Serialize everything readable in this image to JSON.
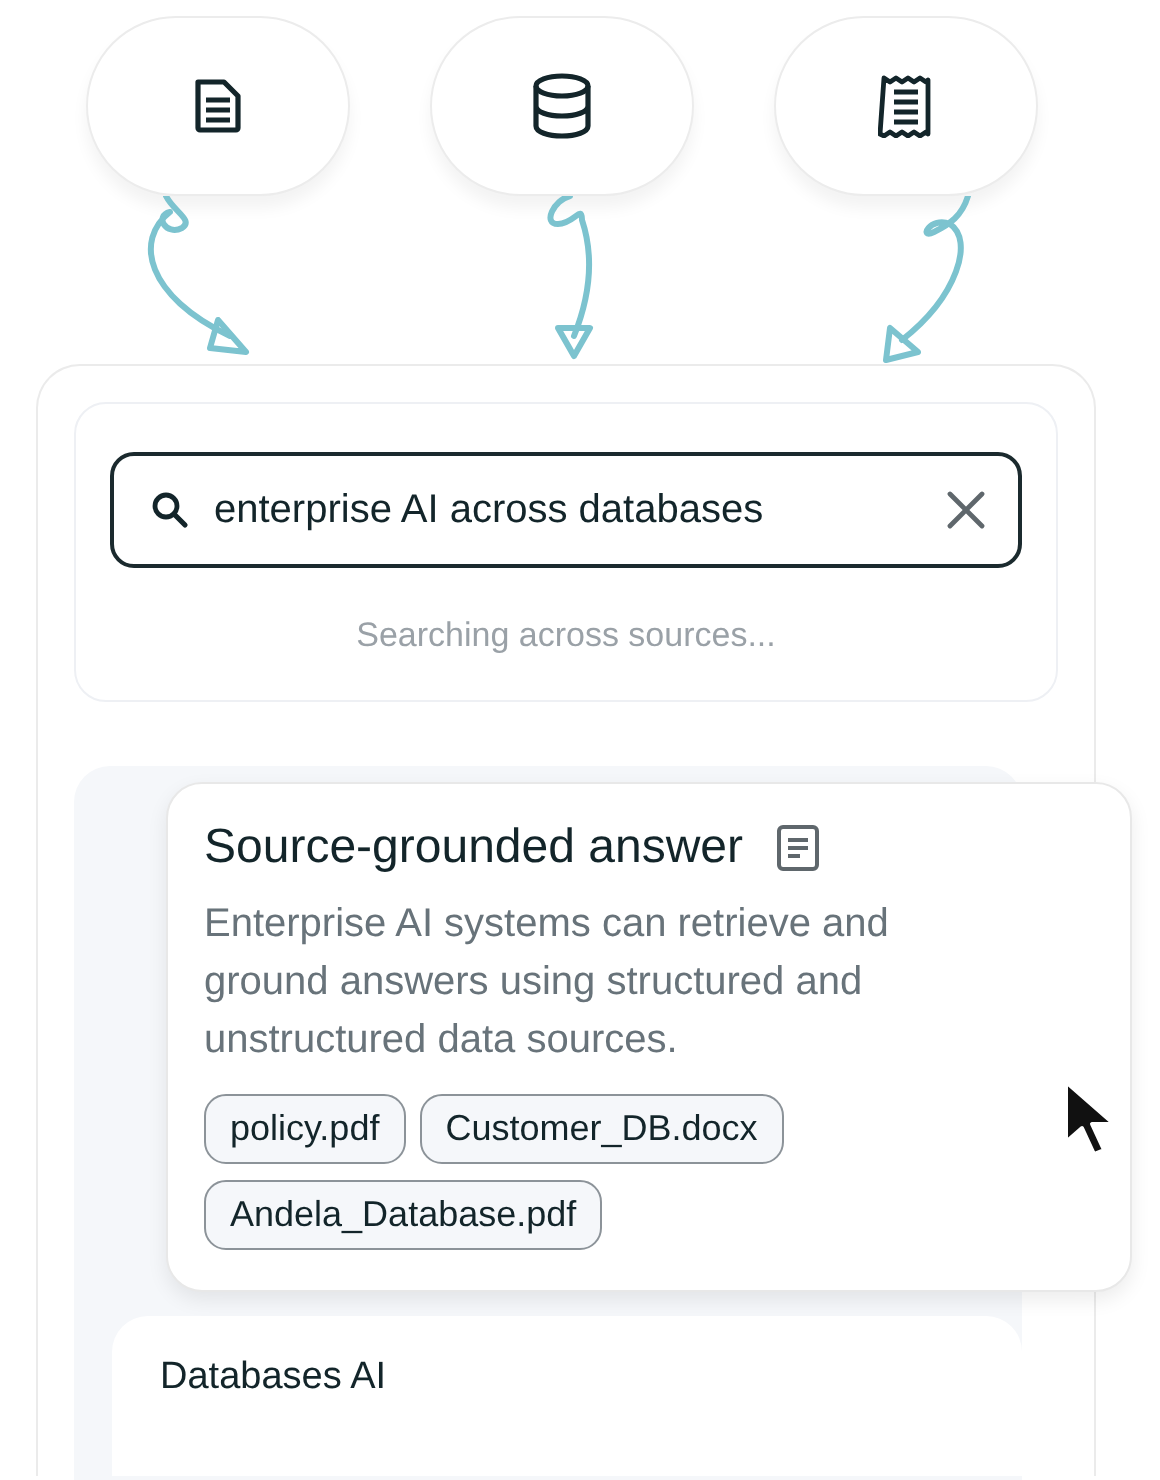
{
  "sources": [
    {
      "kind": "document"
    },
    {
      "kind": "database"
    },
    {
      "kind": "receipt"
    }
  ],
  "search": {
    "value": "enterprise AI across databases"
  },
  "status": "Searching across sources...",
  "answer": {
    "title": "Source-grounded answer",
    "text": "Enterprise AI systems can retrieve and ground answers using structured and unstructured data sources.",
    "sources": [
      "policy.pdf",
      "Customer_DB.docx",
      "Andela_Database.pdf"
    ]
  },
  "results": [
    {
      "title": "Databases AI"
    }
  ]
}
